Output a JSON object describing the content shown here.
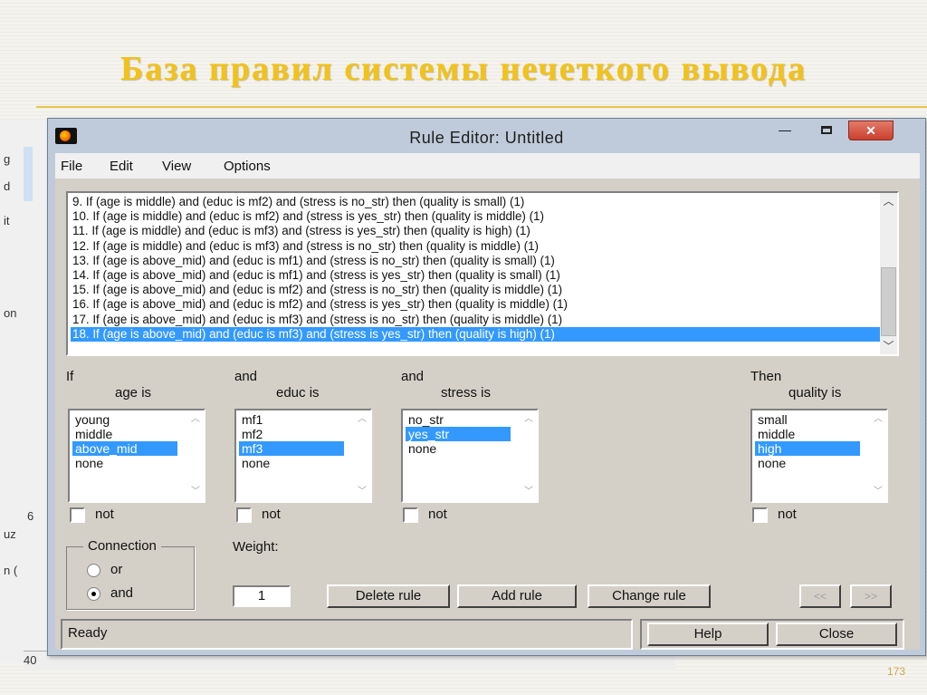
{
  "slide": {
    "title": "База правил системы нечеткого вывода",
    "page_number": "173"
  },
  "background_window": {
    "fragments": [
      "g",
      "d",
      "it",
      "on",
      "uz",
      "n (",
      "6",
      "40"
    ]
  },
  "window": {
    "title": "Rule Editor: Untitled",
    "controls": {
      "minimize": "—",
      "close": "✕"
    }
  },
  "menu": [
    "File",
    "Edit",
    "View",
    "Options"
  ],
  "rules": [
    "9. If (age is middle) and (educ is mf2) and (stress is no_str) then (quality is small) (1)",
    "10. If (age is middle) and (educ is mf2) and (stress is yes_str) then (quality is middle) (1)",
    "11. If (age is middle) and (educ is mf3) and (stress is yes_str) then (quality is high) (1)",
    "12. If (age is middle) and (educ is mf3) and (stress is no_str) then (quality is middle) (1)",
    "13. If (age is above_mid) and (educ is mf1) and (stress is no_str) then (quality is small) (1)",
    "14. If (age is above_mid) and (educ is mf1) and (stress is yes_str) then (quality is small) (1)",
    "15. If (age is above_mid) and (educ is mf2) and (stress is no_str) then (quality is middle) (1)",
    "16. If (age is above_mid) and (educ is mf2) and (stress is yes_str) then (quality is middle) (1)",
    "17. If (age is above_mid) and (educ is mf3) and (stress is no_str) then (quality is middle) (1)",
    "18. If (age is above_mid) and (educ is mf3) and (stress is yes_str) then (quality is high) (1)"
  ],
  "selected_rule": 9,
  "antecedents": [
    {
      "prefix": "If",
      "label": "age is",
      "options": [
        "young",
        "middle",
        "above_mid",
        "none"
      ],
      "selected": 2,
      "not_label": "not"
    },
    {
      "prefix": "and",
      "label": "educ is",
      "options": [
        "mf1",
        "mf2",
        "mf3",
        "none"
      ],
      "selected": 2,
      "not_label": "not"
    },
    {
      "prefix": "and",
      "label": "stress is",
      "options": [
        "no_str",
        "yes_str",
        "none"
      ],
      "selected": 1,
      "not_label": "not"
    }
  ],
  "consequent": {
    "prefix": "Then",
    "label": "quality is",
    "options": [
      "small",
      "middle",
      "high",
      "none"
    ],
    "selected": 2,
    "not_label": "not"
  },
  "connection": {
    "title": "Connection",
    "options": [
      "or",
      "and"
    ],
    "selected": "and"
  },
  "weight": {
    "label": "Weight:",
    "value": "1"
  },
  "buttons": {
    "delete_rule": "Delete rule",
    "add_rule": "Add rule",
    "change_rule": "Change rule",
    "prev": "<<",
    "next": ">>",
    "help": "Help",
    "close": "Close"
  },
  "status": "Ready",
  "colors": {
    "selection": "#3399ff",
    "title_yellow": "#f2c218",
    "panel_gray": "#d4d0c8",
    "window_frame": "#bfcbda"
  }
}
